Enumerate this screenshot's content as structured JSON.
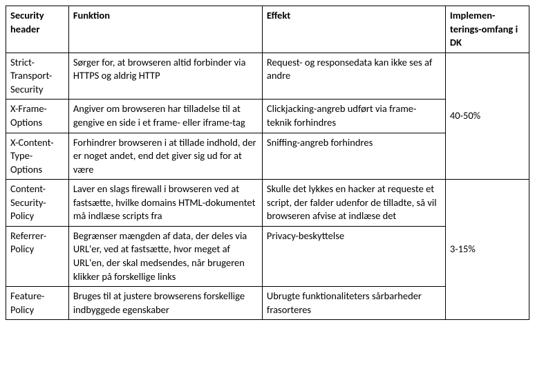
{
  "table": {
    "columns": {
      "security_header": "Security header",
      "funktion": "Funktion",
      "effekt": "Effekt",
      "implementering": "Implemen-terings-omfang i DK"
    },
    "groups": [
      {
        "scope": "40-50%",
        "rows": [
          {
            "header": "Strict-Transport-Security",
            "funktion": "Sørger for, at browseren altid forbinder via HTTPS og aldrig HTTP",
            "effekt": "Request- og responsedata kan ikke ses af andre"
          },
          {
            "header": "X-Frame-Options",
            "funktion": "Angiver om browseren har tilladelse til at gengive en side i et frame- eller iframe-tag",
            "effekt": "Clickjacking-angreb udført via frame-teknik forhindres"
          },
          {
            "header": "X-Content-Type-Options",
            "funktion": "Forhindrer browseren i at tillade indhold, der er noget andet, end det giver sig ud for at være",
            "effekt": "Sniffing-angreb forhindres"
          }
        ]
      },
      {
        "scope": "3-15%",
        "rows": [
          {
            "header": "Content-Security-Policy",
            "funktion": "Laver en slags firewall i browseren ved at fastsætte, hvilke domains HTML-dokumentet må indlæse scripts fra",
            "effekt": "Skulle det lykkes en hacker at requeste et script, der falder udenfor de tilladte, så vil browseren afvise at indlæse det"
          },
          {
            "header": "Referrer-Policy",
            "funktion": "Begrænser mængden af data, der deles via URL'er, ved at fastsætte, hvor meget af URL'en, der skal medsendes, når brugeren klikker på forskellige links",
            "effekt": "Privacy-beskyttelse"
          },
          {
            "header": "Feature-Policy",
            "funktion": "Bruges til at justere browserens forskellige indbyggede egenskaber",
            "effekt": "Ubrugte funktionaliteters sårbarheder frasorteres"
          }
        ]
      }
    ]
  }
}
